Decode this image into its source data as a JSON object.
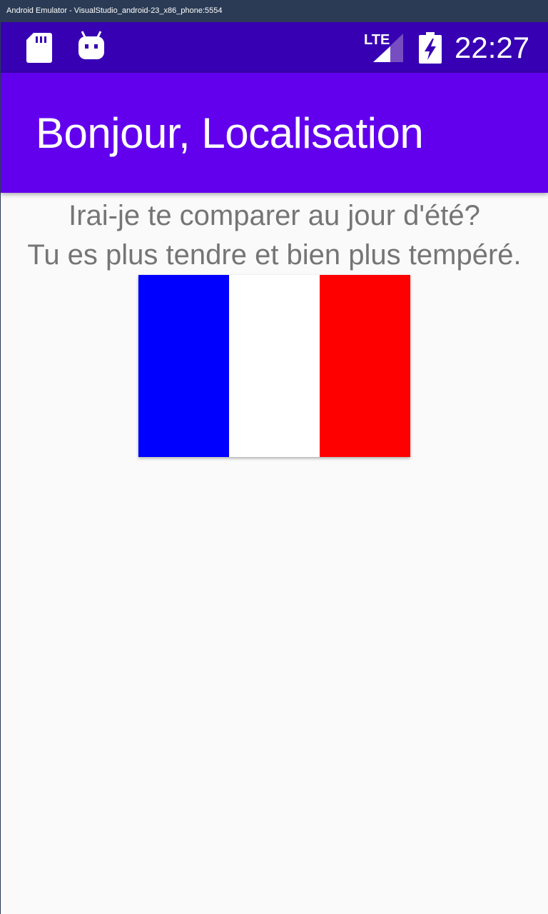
{
  "window": {
    "title": "Android Emulator - VisualStudio_android-23_x86_phone:5554"
  },
  "status_bar": {
    "time": "22:27",
    "network_label": "LTE",
    "icons": [
      "sd-card-icon",
      "android-debug-icon",
      "lte-signal-icon",
      "battery-charging-icon"
    ]
  },
  "app_bar": {
    "title": "Bonjour, Localisation"
  },
  "content": {
    "poem_line_1": "Irai-je te comparer au jour d'été?",
    "poem_line_2": "Tu es plus tendre et bien plus tempéré."
  },
  "flag": {
    "stripes": [
      "#0000ff",
      "#ffffff",
      "#ff0000"
    ]
  },
  "colors": {
    "status_bar": "#3700b3",
    "app_bar": "#6200ee",
    "background": "#fafafa",
    "body_text": "#757575"
  }
}
